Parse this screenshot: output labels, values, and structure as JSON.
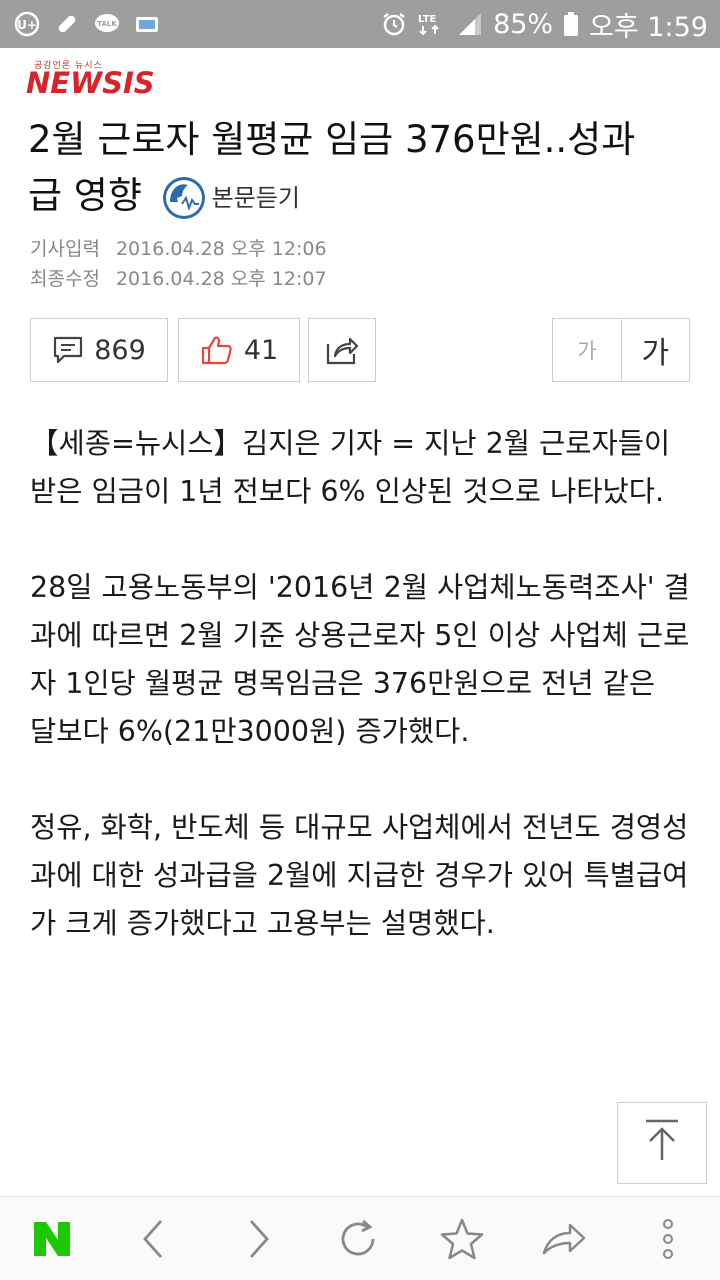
{
  "status_bar": {
    "battery": "85%",
    "time": "오후 1:59",
    "network": "LTE"
  },
  "header": {
    "logo_tagline": "공감언론 뉴시스",
    "logo": "NEWSIS"
  },
  "article": {
    "title_line1": "2월 근로자 월평균 임금 376만원..성과",
    "title_line2": "급 영향",
    "listen_label": "본문듣기",
    "meta": {
      "published_label": "기사입력",
      "published_value": "2016.04.28 오후 12:06",
      "updated_label": "최종수정",
      "updated_value": "2016.04.28 오후 12:07"
    },
    "comments_count": "869",
    "likes_count": "41",
    "font_small_label": "가",
    "font_large_label": "가",
    "paragraphs": [
      "【세종=뉴시스】김지은 기자 = 지난 2월 근로자들이 받은 임금이 1년 전보다 6% 인상된 것으로 나타났다.",
      "28일 고용노동부의 '2016년 2월 사업체노동력조사' 결과에 따르면 2월 기준 상용근로자 5인 이상 사업체 근로자 1인당 월평균 명목임금은 376만원으로 전년 같은 달보다 6%(21만3000원) 증가했다.",
      "정유, 화학, 반도체 등 대규모 사업체에서 전년도 경영성과에 대한 성과급을 2월에 지급한 경우가 있어 특별급여가 크게 증가했다고 고용부는 설명했다."
    ]
  },
  "bottom_nav": {
    "home_logo": "N",
    "items": [
      "naver-home",
      "back",
      "forward",
      "refresh",
      "bookmark",
      "share",
      "more"
    ]
  },
  "colors": {
    "status_bar_bg": "#9e9e9e",
    "brand_red": "#d8232a",
    "naver_green": "#1ec800",
    "like_red": "#e8453c"
  }
}
